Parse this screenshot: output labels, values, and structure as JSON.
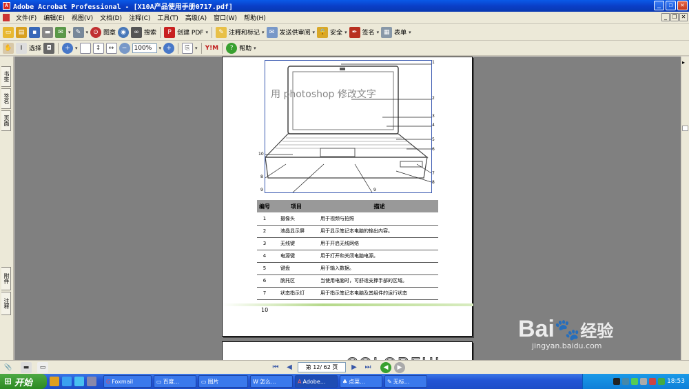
{
  "titlebar": {
    "title": "Adobe Acrobat Professional - [X10A产品使用手册0717.pdf]",
    "app_icon": "A"
  },
  "menubar": {
    "items": [
      "文件(F)",
      "编辑(E)",
      "视图(V)",
      "文档(D)",
      "注释(C)",
      "工具(T)",
      "高级(A)",
      "窗口(W)",
      "帮助(H)"
    ]
  },
  "toolbar1": {
    "stamp": "图章",
    "search": "搜索",
    "create_pdf": "创建 PDF",
    "comment_markup": "注释和标记",
    "send_review": "发送供审阅",
    "security": "安全",
    "sign": "签名",
    "forms": "表单"
  },
  "toolbar2": {
    "select": "选择",
    "zoom": "100%",
    "help": "帮助",
    "logo_text": "Y!M"
  },
  "left_tabs": [
    "书签",
    "签名",
    "页面",
    "附件",
    "注释"
  ],
  "page": {
    "overlay_text": "用 photoshop 修改文字",
    "callouts": [
      "1",
      "2",
      "3",
      "4",
      "5",
      "6",
      "7",
      "8",
      "10",
      "8",
      "9",
      "9"
    ],
    "table": {
      "headers": [
        "编号",
        "项目",
        "描述"
      ],
      "rows": [
        [
          "1",
          "摄像头",
          "用于视频与拍照"
        ],
        [
          "2",
          "液晶显示屏",
          "用于显示笔记本电脑的输出内容。"
        ],
        [
          "3",
          "无线键",
          "用于开启无线网络"
        ],
        [
          "4",
          "电源键",
          "用于打开和关闭电脑电源。"
        ],
        [
          "5",
          "键盘",
          "用于输入数据。"
        ],
        [
          "6",
          "腕托区",
          "当使用电脑时，可舒适支撑手部的区域。"
        ],
        [
          "7",
          "状态指示灯",
          "用于指示笔记本电脑及其组件的运行状态"
        ]
      ]
    },
    "page_number": "10",
    "next_page_text": "COLORFUL"
  },
  "statusbar": {
    "page_indicator": "第 12/ 62 页"
  },
  "taskbar": {
    "start": "开始",
    "tasks": [
      "Foxmail",
      "百度...",
      "图片",
      "怎么...",
      "Adobe...",
      "点菜...",
      "无标..."
    ],
    "clock": "18:53"
  },
  "watermark": {
    "brand": "Bai",
    "brand2": "经验",
    "url": "jingyan.baidu.com"
  }
}
